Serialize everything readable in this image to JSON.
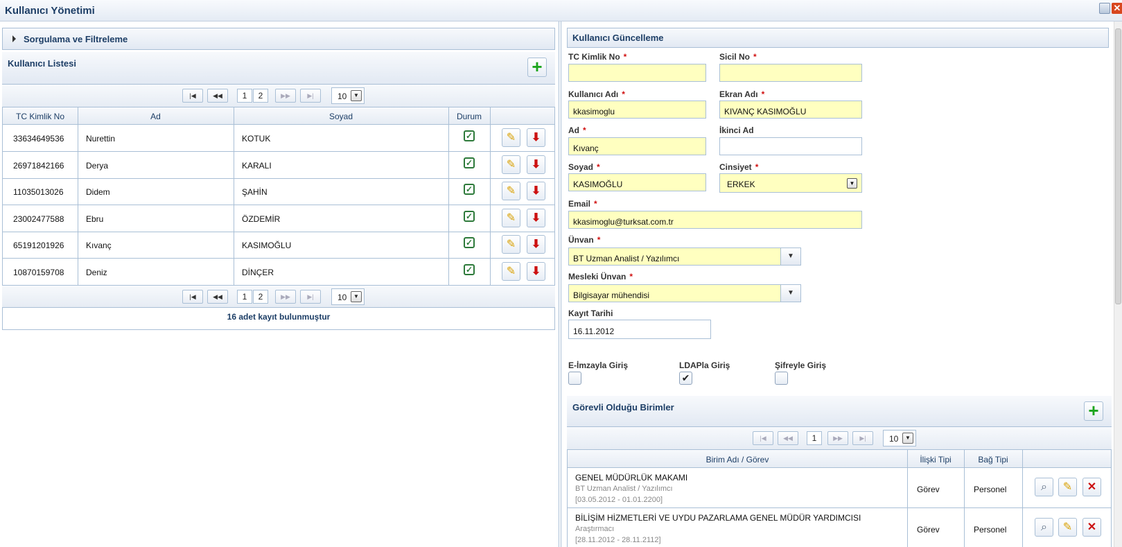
{
  "window": {
    "title": "Kullanıcı Yönetimi"
  },
  "filter_panel": {
    "title": "Sorgulama ve Filtreleme"
  },
  "user_list": {
    "title": "Kullanıcı Listesi",
    "pager": {
      "pages": [
        "1",
        "2"
      ],
      "page_size": "10"
    },
    "columns": [
      "TC Kimlik No",
      "Ad",
      "Soyad",
      "Durum"
    ],
    "rows": [
      {
        "tc": "33634649536",
        "ad": "Nurettin",
        "soyad": "KOTUK"
      },
      {
        "tc": "26971842166",
        "ad": "Derya",
        "soyad": "KARALI"
      },
      {
        "tc": "11035013026",
        "ad": "Didem",
        "soyad": "ŞAHİN"
      },
      {
        "tc": "23002477588",
        "ad": "Ebru",
        "soyad": "ÖZDEMİR"
      },
      {
        "tc": "65191201926",
        "ad": "Kıvanç",
        "soyad": "KASIMOĞLU"
      },
      {
        "tc": "10870159708",
        "ad": "Deniz",
        "soyad": "DİNÇER"
      }
    ],
    "footer": "16 adet kayıt bulunmuştur"
  },
  "update_form": {
    "title": "Kullanıcı Güncelleme",
    "tc_label": "TC Kimlik No",
    "tc_value": "",
    "sicil_label": "Sicil No",
    "sicil_value": "",
    "kullanici_adi_label": "Kullanıcı Adı",
    "kullanici_adi_value": "kkasimoglu",
    "ekran_adi_label": "Ekran Adı",
    "ekran_adi_value": "KIVANÇ KASIMOĞLU",
    "ad_label": "Ad",
    "ad_value": "Kıvanç",
    "ikinci_ad_label": "İkinci Ad",
    "ikinci_ad_value": "",
    "soyad_label": "Soyad",
    "soyad_value": "KASIMOĞLU",
    "cinsiyet_label": "Cinsiyet",
    "cinsiyet_value": "ERKEK",
    "email_label": "Email",
    "email_value": "kkasimoglu@turksat.com.tr",
    "unvan_label": "Ünvan",
    "unvan_value": "BT Uzman Analist / Yazılımcı",
    "mesleki_unvan_label": "Mesleki Ünvan",
    "mesleki_unvan_value": "Bilgisayar mühendisi",
    "kayit_tarihi_label": "Kayıt Tarihi",
    "kayit_tarihi_value": "16.11.2012",
    "eimza_label": "E-İmzayla Giriş",
    "ldap_label": "LDAPla Giriş",
    "sifre_label": "Şifreyle Giriş"
  },
  "units": {
    "title": "Görevli Olduğu Birimler",
    "pager": {
      "pages": [
        "1"
      ],
      "page_size": "10"
    },
    "columns": [
      "Birim Adı / Görev",
      "İlişki Tipi",
      "Bağ Tipi"
    ],
    "rows": [
      {
        "name": "GENEL MÜDÜRLÜK MAKAMI",
        "role": "BT Uzman Analist / Yazılımcı",
        "dates": "[03.05.2012 - 01.01.2200]",
        "iliski": "Görev",
        "bag": "Personel"
      },
      {
        "name": "BİLİŞİM HİZMETLERİ VE UYDU PAZARLAMA GENEL MÜDÜR YARDIMCISI",
        "role": "Araştırmacı",
        "dates": "[28.11.2012 - 28.11.2112]",
        "iliski": "Görev",
        "bag": "Personel"
      }
    ]
  }
}
